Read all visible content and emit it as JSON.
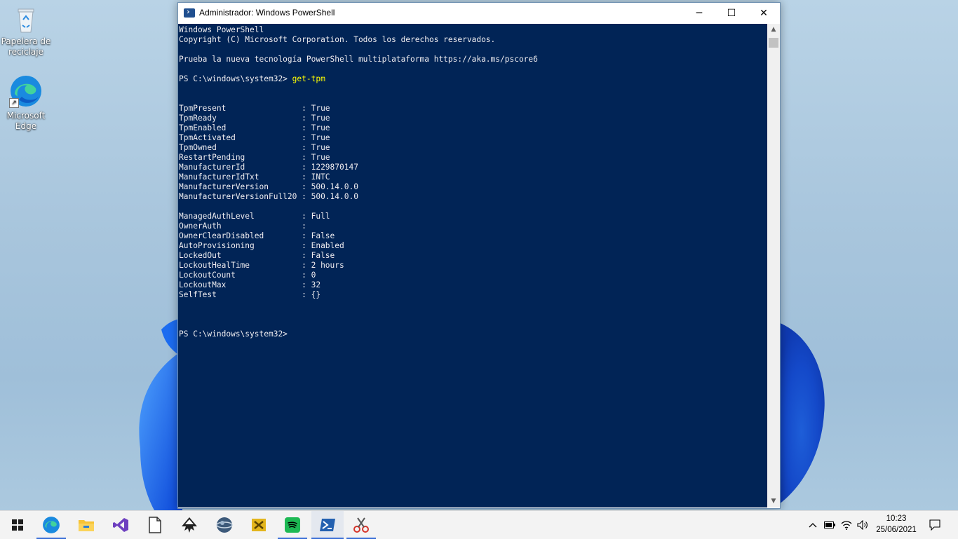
{
  "desktop": {
    "icons": [
      {
        "label": "Papelera de reciclaje",
        "icon": "recycle-bin-icon"
      },
      {
        "label": "Microsoft Edge",
        "icon": "edge-icon"
      }
    ]
  },
  "window": {
    "title": "Administrador: Windows PowerShell",
    "controls": {
      "minimize": "─",
      "maximize": "☐",
      "close": "✕"
    },
    "console": {
      "header_lines": [
        "Windows PowerShell",
        "Copyright (C) Microsoft Corporation. Todos los derechos reservados.",
        "",
        "Prueba la nueva tecnología PowerShell multiplataforma https://aka.ms/pscore6",
        ""
      ],
      "prompt": "PS C:\\windows\\system32> ",
      "command": "get-tpm",
      "properties": [
        {
          "name": "TpmPresent",
          "value": "True"
        },
        {
          "name": "TpmReady",
          "value": "True"
        },
        {
          "name": "TpmEnabled",
          "value": "True"
        },
        {
          "name": "TpmActivated",
          "value": "True"
        },
        {
          "name": "TpmOwned",
          "value": "True"
        },
        {
          "name": "RestartPending",
          "value": "True"
        },
        {
          "name": "ManufacturerId",
          "value": "1229870147"
        },
        {
          "name": "ManufacturerIdTxt",
          "value": "INTC"
        },
        {
          "name": "ManufacturerVersion",
          "value": "500.14.0.0"
        },
        {
          "name": "ManufacturerVersionFull20",
          "value": "500.14.0.0"
        },
        {
          "name": "",
          "value": ""
        },
        {
          "name": "ManagedAuthLevel",
          "value": "Full"
        },
        {
          "name": "OwnerAuth",
          "value": ""
        },
        {
          "name": "OwnerClearDisabled",
          "value": "False"
        },
        {
          "name": "AutoProvisioning",
          "value": "Enabled"
        },
        {
          "name": "LockedOut",
          "value": "False"
        },
        {
          "name": "LockoutHealTime",
          "value": "2 hours"
        },
        {
          "name": "LockoutCount",
          "value": "0"
        },
        {
          "name": "LockoutMax",
          "value": "32"
        },
        {
          "name": "SelfTest",
          "value": "{}"
        }
      ],
      "final_prompt": "PS C:\\windows\\system32>"
    }
  },
  "taskbar": {
    "apps": [
      {
        "name": "start-button",
        "icon": "windows-logo-icon",
        "active": false
      },
      {
        "name": "edge",
        "icon": "edge-icon",
        "active": true
      },
      {
        "name": "file-explorer",
        "icon": "folder-icon",
        "active": false
      },
      {
        "name": "visual-studio",
        "icon": "visual-studio-icon",
        "active": false
      },
      {
        "name": "notepad",
        "icon": "document-icon",
        "active": false
      },
      {
        "name": "inkscape",
        "icon": "inkscape-icon",
        "active": false
      },
      {
        "name": "app-sphere",
        "icon": "sphere-icon",
        "active": false
      },
      {
        "name": "app-tools",
        "icon": "tools-icon",
        "active": false
      },
      {
        "name": "spotify",
        "icon": "spotify-icon",
        "active": true
      },
      {
        "name": "powershell",
        "icon": "powershell-icon",
        "active": true
      },
      {
        "name": "snipping-tool",
        "icon": "scissors-icon",
        "active": true
      }
    ],
    "tray": {
      "chevron": "^",
      "time": "10:23",
      "date": "25/06/2021"
    }
  }
}
